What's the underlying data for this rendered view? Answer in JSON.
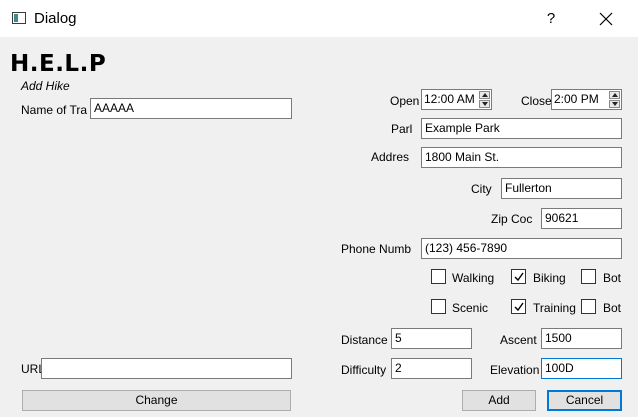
{
  "window": {
    "title": "Dialog",
    "help_glyph": "?"
  },
  "header": {
    "logo_text": "H.E.L.P",
    "subtitle": "Add Hike"
  },
  "form": {
    "name": {
      "label": "Name of Tra",
      "value": "AAAAA"
    },
    "url": {
      "label": "URL",
      "value": ""
    },
    "change_button": "Change",
    "open": {
      "label": "Open",
      "value": "12:00 AM"
    },
    "close": {
      "label": "Close",
      "value": "2:00 PM"
    },
    "park": {
      "label": "Parl",
      "value": "Example Park"
    },
    "address": {
      "label": "Addres",
      "value": "1800 Main St."
    },
    "city": {
      "label": "City",
      "value": "Fullerton"
    },
    "zip": {
      "label": "Zip Coc",
      "value": "90621"
    },
    "phone": {
      "label": "Phone Numb",
      "value": "(123) 456-7890"
    },
    "activities_row1": [
      {
        "label": "Walking",
        "checked": false
      },
      {
        "label": "Biking",
        "checked": true
      },
      {
        "label": "Bot",
        "checked": false
      }
    ],
    "activities_row2": [
      {
        "label": "Scenic",
        "checked": false
      },
      {
        "label": "Training",
        "checked": true
      },
      {
        "label": "Bot",
        "checked": false
      }
    ],
    "distance": {
      "label": "Distance",
      "value": "5"
    },
    "ascent": {
      "label": "Ascent",
      "value": "1500"
    },
    "difficulty": {
      "label": "Difficulty",
      "value": "2"
    },
    "elevation": {
      "label": "Elevation",
      "value": "100D"
    }
  },
  "buttons": {
    "add": "Add",
    "cancel": "Cancel"
  },
  "colors": {
    "focus": "#0078d7",
    "background": "#f0f0f0"
  }
}
